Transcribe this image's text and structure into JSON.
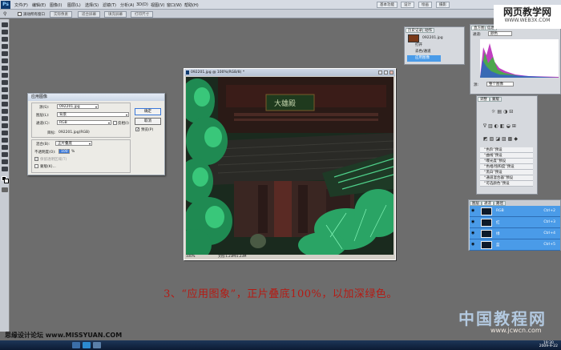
{
  "menubar": {
    "app_icon": "Ps",
    "items": [
      "文件(F)",
      "编辑(E)",
      "图像(I)",
      "图层(L)",
      "选择(S)",
      "滤镜(T)",
      "分析(A)",
      "3D(D)",
      "视图(V)",
      "窗口(W)",
      "帮助(H)"
    ],
    "right_buttons": [
      "基本功能",
      "设计",
      "绘画",
      "摄影"
    ]
  },
  "options_bar": {
    "checkbox_label": "滚动所有窗口",
    "buttons": [
      "实际像素",
      "适合屏幕",
      "填充屏幕",
      "打印尺寸"
    ]
  },
  "document": {
    "title": "092201.jpg @ 100%(RGB/8) *",
    "zoom": "100%",
    "status": "文档:1.23M/1.23M"
  },
  "dialog": {
    "title": "应用图像",
    "source_label": "源(S):",
    "source_value": "092201.jpg",
    "layer_label": "图层(L):",
    "layer_value": "背景",
    "channel_label": "通道(C):",
    "channel_value": "RGB",
    "invert_label": "反相(I)",
    "target_label": "目标:",
    "target_value": "092201.jpg(RGB)",
    "blending_label": "混合(B):",
    "blending_value": "正片叠底",
    "opacity_label": "不透明度(O):",
    "opacity_value": "100",
    "opacity_unit": "%",
    "preserve_label": "保留透明区域(T)",
    "mask_label": "蒙版(K)...",
    "ok": "确定",
    "cancel": "取消",
    "preview_label": "预览(P)"
  },
  "history_panel": {
    "tabs": [
      "历史记录",
      "动作"
    ],
    "snapshot": "092201.jpg",
    "items": [
      "打开",
      "去色/通道",
      "应用图像"
    ]
  },
  "histogram_panel": {
    "tabs": [
      "直方图",
      "信息"
    ],
    "channel_label": "通道:",
    "channel_value": "颜色",
    "source_label": "源:",
    "source_value": "整个图像"
  },
  "adjustments_panel": {
    "tabs": [
      "调整",
      "蒙版"
    ],
    "presets": [
      "“色阶”预设",
      "“曲线”预设",
      "“曝光度”预设",
      "“色相/饱和度”预设",
      "“黑白”预设",
      "“通道混合器”预设",
      "“可选颜色”预设"
    ]
  },
  "layers_panel": {
    "tabs": [
      "图层",
      "通道",
      "路径"
    ],
    "rows": [
      {
        "name": "RGB",
        "shortcut": "Ctrl+2"
      },
      {
        "name": "红",
        "shortcut": "Ctrl+3"
      },
      {
        "name": "绿",
        "shortcut": "Ctrl+4"
      },
      {
        "name": "蓝",
        "shortcut": "Ctrl+5"
      }
    ]
  },
  "caption": "3、“应用图象”，正片叠底100%，以加深绿色。",
  "watermarks": {
    "top_right_1": "网页教学网",
    "top_right_2": "WWW.WEB3X.COM",
    "bottom_right_1": "中国教程网",
    "bottom_right_2": "www.jcwcn.com",
    "bottom_left": "思缘设计论坛 www.MISSYUAN.COM"
  },
  "taskbar": {
    "time": "19:30",
    "date": "2009-9-22"
  },
  "colors": {
    "accent_selection": "#4a9be8",
    "caption_red": "#b51b14",
    "ps_blue": "#0e3a6e"
  }
}
